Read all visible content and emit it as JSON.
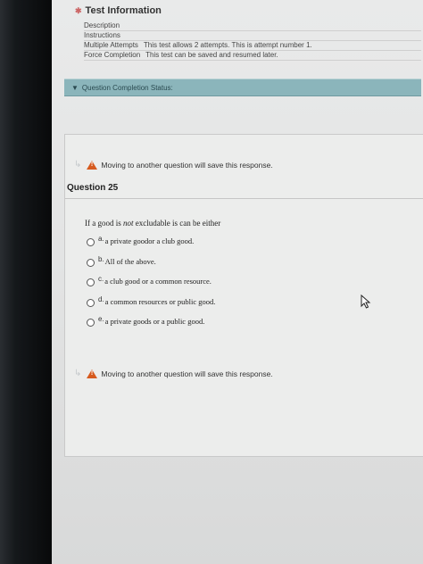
{
  "test_info": {
    "title": "Test Information",
    "rows": [
      {
        "label": "Description",
        "value": ""
      },
      {
        "label": "Instructions",
        "value": ""
      },
      {
        "label": "Multiple Attempts",
        "value": "This test allows 2 attempts. This is attempt number 1."
      },
      {
        "label": "Force Completion",
        "value": "This test can be saved and resumed later."
      }
    ]
  },
  "status_bar": {
    "label": "Question Completion Status:"
  },
  "warnings": {
    "top": "Moving to another question will save this response.",
    "bottom": "Moving to another question will save this response."
  },
  "question": {
    "title": "Question 25",
    "text_before": "If a good is ",
    "text_emph": "not",
    "text_after": " excludable is can be either",
    "options": [
      {
        "letter": "a.",
        "text": "a private goodor a club good."
      },
      {
        "letter": "b.",
        "text": "All of the above."
      },
      {
        "letter": "c.",
        "text": "a club good or a common resource."
      },
      {
        "letter": "d.",
        "text": "a common resources or public good."
      },
      {
        "letter": "e.",
        "text": "a private goods or a public good."
      }
    ]
  },
  "colors": {
    "status_bar": "#8bb5bb",
    "alert": "#d65a1e"
  }
}
